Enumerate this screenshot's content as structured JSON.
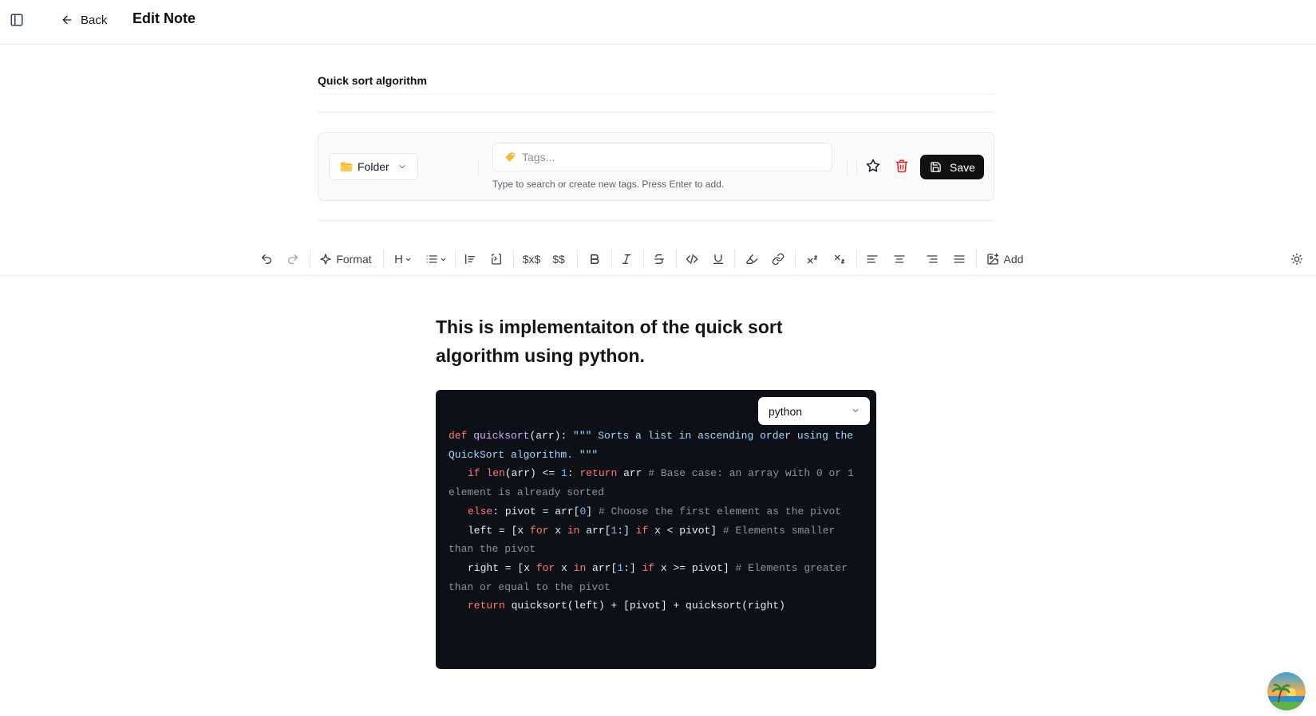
{
  "header": {
    "back_label": "Back",
    "title": "Edit Note"
  },
  "note": {
    "title": "Quick sort algorithm"
  },
  "meta": {
    "folder_label": "Folder",
    "tags_placeholder": "Tags...",
    "tags_help": "Type to search or create new tags. Press Enter to add.",
    "save_label": "Save"
  },
  "toolbar": {
    "format_label": "Format",
    "heading_label": "H",
    "inline_math_label": "$x$",
    "block_math_label": "$$",
    "add_label": "Add"
  },
  "content": {
    "heading": "This is implementaiton of the quick sort algorithm using python.",
    "code_language": "python",
    "code_lines": [
      "def quicksort(arr): \"\"\" Sorts a list in ascending order using the QuickSort algorithm. \"\"\"",
      "if len(arr) <= 1: return arr # Base case: an array with 0 or 1 element is already sorted",
      "else: pivot = arr[0] # Choose the first element as the pivot",
      "left = [x for x in arr[1:] if x < pivot] # Elements smaller than the pivot",
      "right = [x for x in arr[1:] if x >= pivot] # Elements greater than or equal to the pivot",
      "return quicksort(left) + [pivot] + quicksort(right)"
    ]
  },
  "colors": {
    "save_bg": "#111111",
    "delete_icon": "#dc2626",
    "code_bg": "#0d1117",
    "keyword": "#ff7b72",
    "function": "#d2a8ff",
    "string": "#a5d6ff",
    "number": "#79c0ff",
    "comment": "#8b949e"
  }
}
